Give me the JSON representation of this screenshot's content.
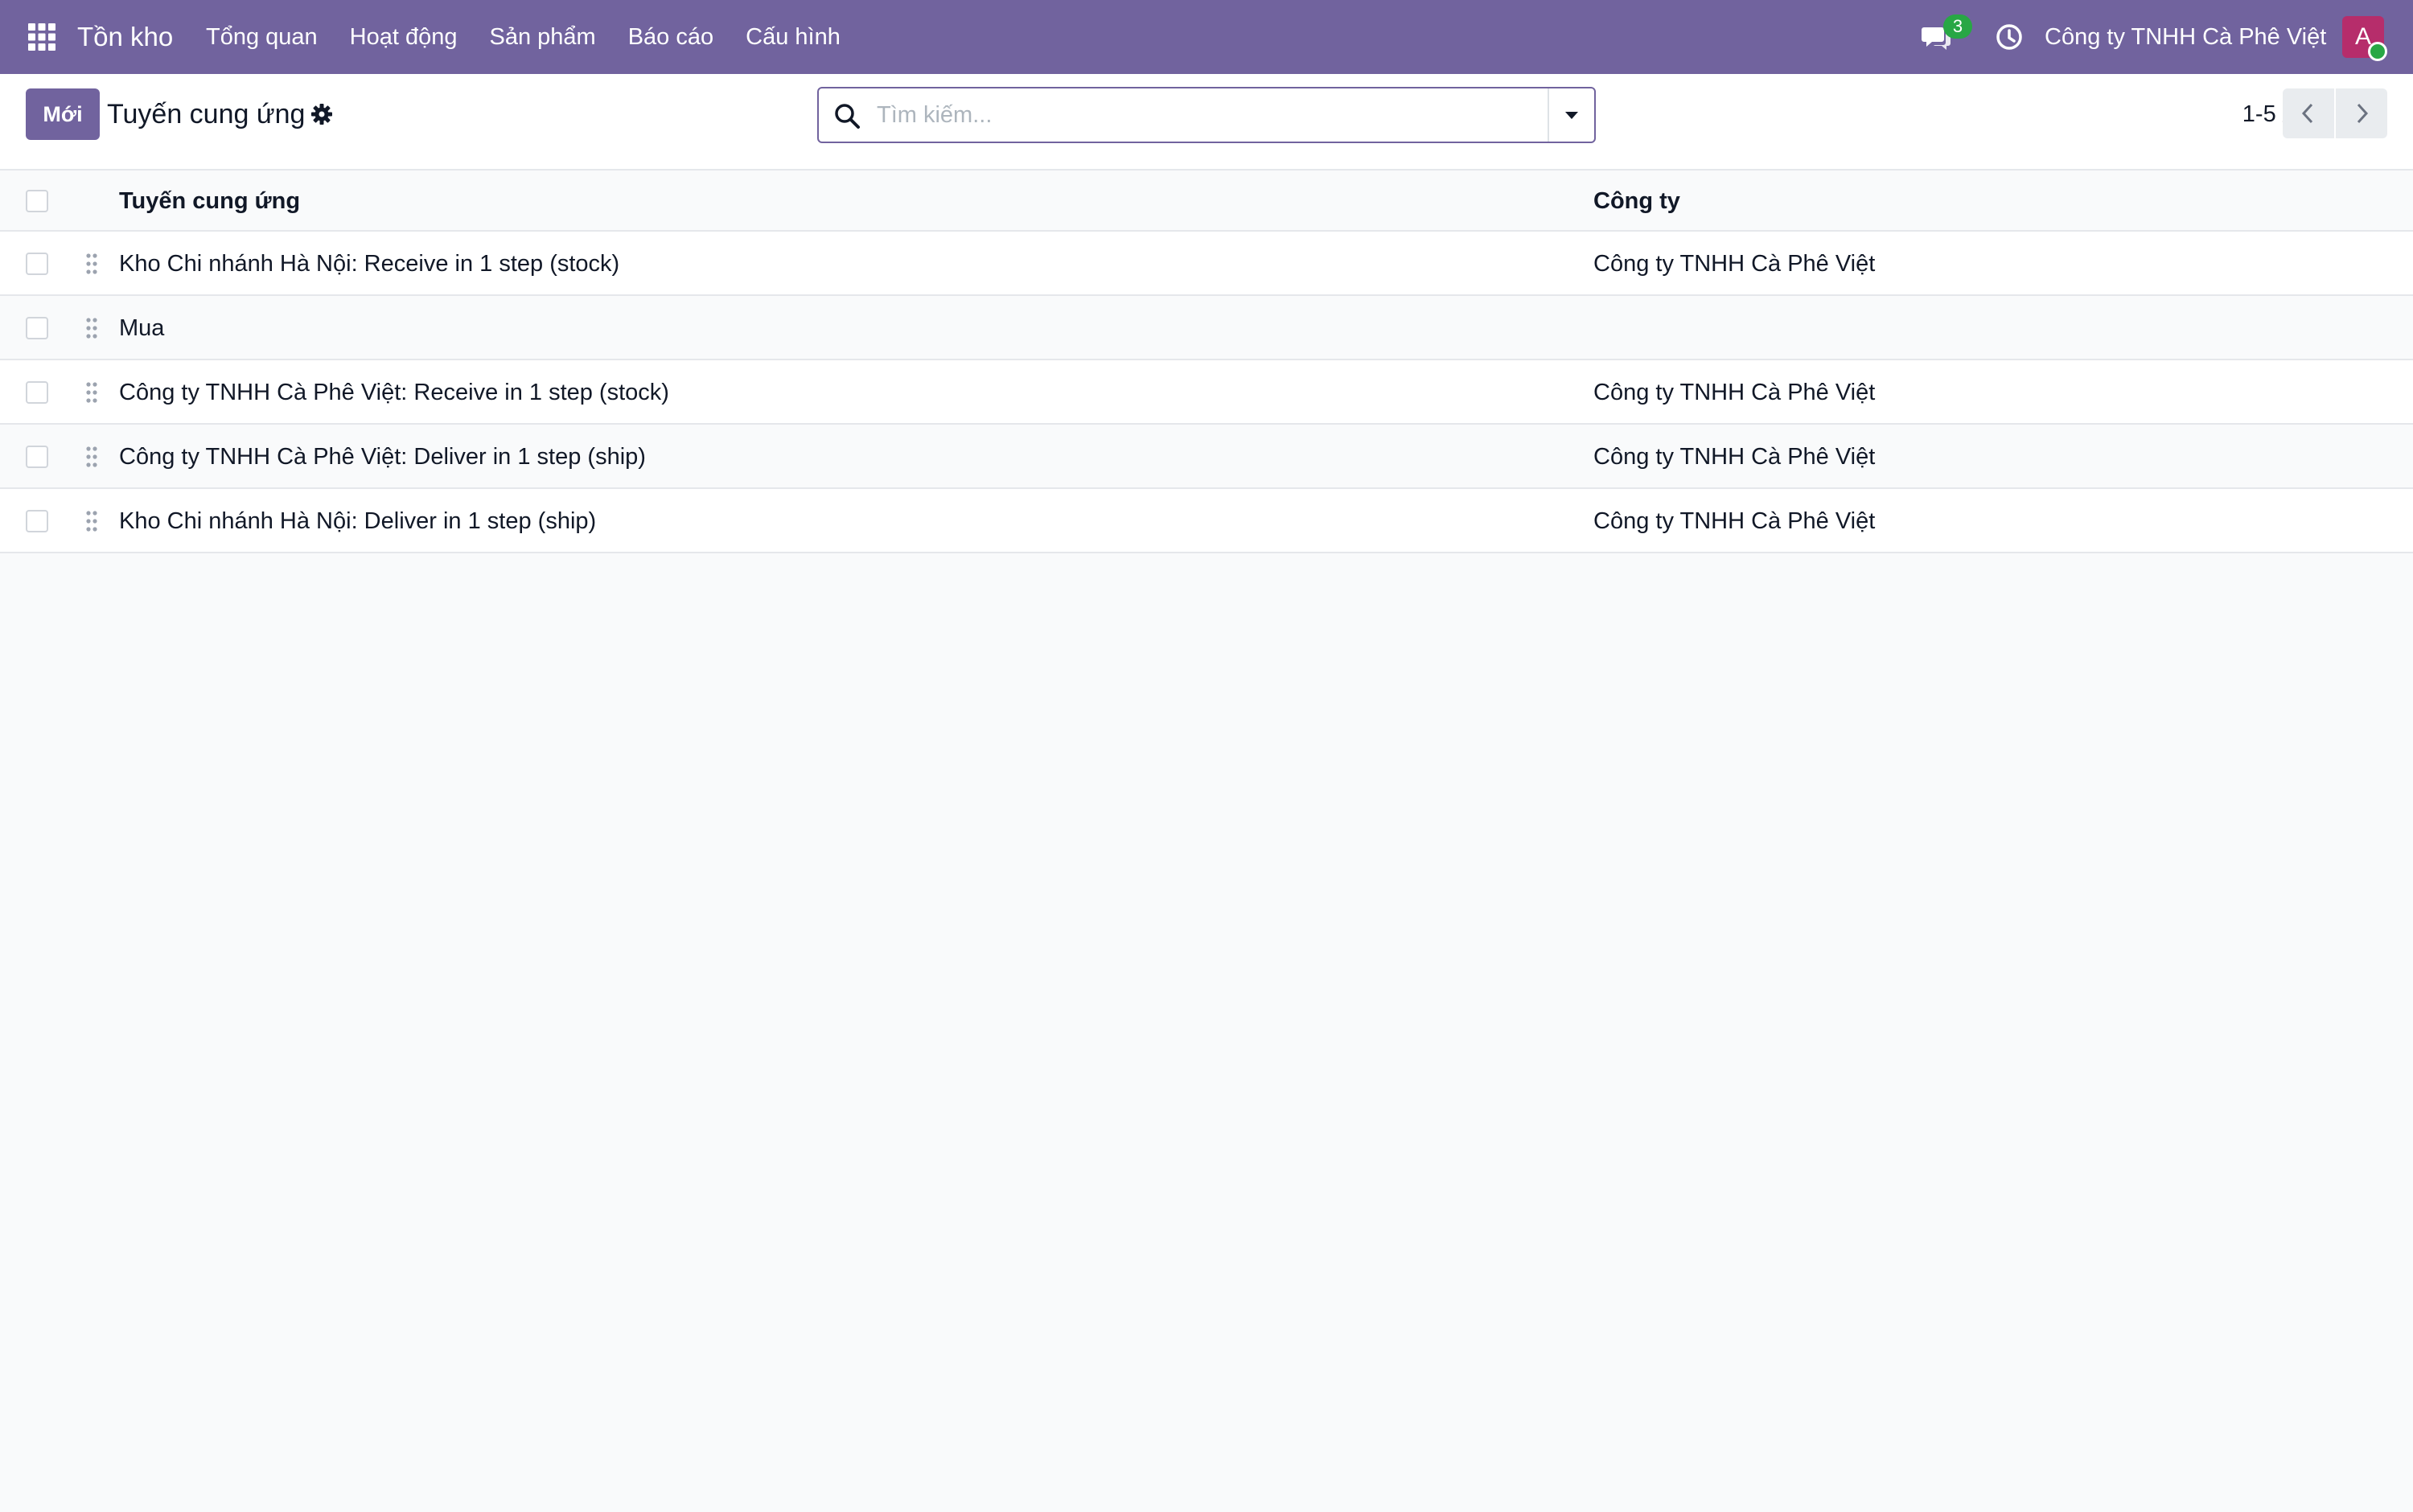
{
  "navbar": {
    "app_title": "Tồn kho",
    "menu": [
      "Tổng quan",
      "Hoạt động",
      "Sản phẩm",
      "Báo cáo",
      "Cấu hình"
    ],
    "message_count": "3",
    "company": "Công ty TNHH Cà Phê Việt",
    "avatar_initial": "A",
    "colors": {
      "navbar": "#71639e",
      "badge": "#28a745",
      "avatar": "#b62d6b"
    }
  },
  "control_panel": {
    "new_label": "Mới",
    "title": "Tuyến cung ứng",
    "search_placeholder": "Tìm kiếm...",
    "pager": "1-5 / 5"
  },
  "table": {
    "columns": [
      "Tuyến cung ứng",
      "Công ty"
    ],
    "rows": [
      {
        "name": "Kho Chi nhánh Hà Nội: Receive in 1 step (stock)",
        "company": "Công ty TNHH Cà Phê Việt"
      },
      {
        "name": "Mua",
        "company": ""
      },
      {
        "name": "Công ty TNHH Cà Phê Việt: Receive in 1 step (stock)",
        "company": "Công ty TNHH Cà Phê Việt"
      },
      {
        "name": "Công ty TNHH Cà Phê Việt: Deliver in 1 step (ship)",
        "company": "Công ty TNHH Cà Phê Việt"
      },
      {
        "name": "Kho Chi nhánh Hà Nội: Deliver in 1 step (ship)",
        "company": "Công ty TNHH Cà Phê Việt"
      }
    ]
  },
  "icons": [
    "apps-grid-icon",
    "chat-icon",
    "clock-icon",
    "gear-icon",
    "search-icon",
    "caret-down-icon",
    "chevron-left-icon",
    "chevron-right-icon",
    "drag-handle-icon"
  ]
}
